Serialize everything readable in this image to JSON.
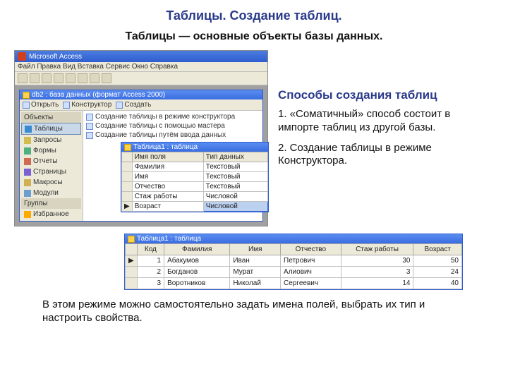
{
  "title": "Таблицы. Создание таблиц.",
  "subtitle": "Таблицы — основные объекты базы данных.",
  "app": {
    "name": "Microsoft Access",
    "menu": "Файл  Правка  Вид  Вставка  Сервис  Окно  Справка",
    "db_title": "db2 : база данных (формат Access 2000)",
    "tools": {
      "open": "Открыть",
      "design": "Конструктор",
      "new": "Создать"
    },
    "nav_header": "Объекты",
    "nav": [
      "Таблицы",
      "Запросы",
      "Формы",
      "Отчеты",
      "Страницы",
      "Макросы",
      "Модули"
    ],
    "nav_group": "Группы",
    "nav_fav": "Избранное",
    "create": [
      "Создание таблицы в режиме конструктора",
      "Создание таблицы с помощью мастера",
      "Создание таблицы путём ввода данных"
    ],
    "design_win": {
      "title": "Таблица1 : таблица",
      "headers": [
        "Имя поля",
        "Тип данных"
      ],
      "rows": [
        [
          "Фамилия",
          "Текстовый"
        ],
        [
          "Имя",
          "Текстовый"
        ],
        [
          "Отчество",
          "Текстовый"
        ],
        [
          "Стаж работы",
          "Числовой"
        ],
        [
          "Возраст",
          "Числовой"
        ]
      ]
    }
  },
  "right": {
    "heading": "Способы создания таблиц",
    "m1": "1. «Соматичный» способ состоит в импорте таблиц из другой базы.",
    "m2": "2.  Создание таблицы в режиме Конструктора."
  },
  "datasheet": {
    "title": "Таблица1 : таблица",
    "headers": [
      "Код",
      "Фамилия",
      "Имя",
      "Отчество",
      "Стаж работы",
      "Возраст"
    ],
    "rows": [
      [
        "1",
        "Абакумов",
        "Иван",
        "Петрович",
        "30",
        "50"
      ],
      [
        "2",
        "Богданов",
        "Мурат",
        "Алиович",
        "3",
        "24"
      ],
      [
        "3",
        "Воротников",
        "Николай",
        "Сергеевич",
        "14",
        "40"
      ]
    ]
  },
  "bottom": "В этом режиме можно самостоятельно задать имена полей, выбрать их тип и  настроить свойства."
}
